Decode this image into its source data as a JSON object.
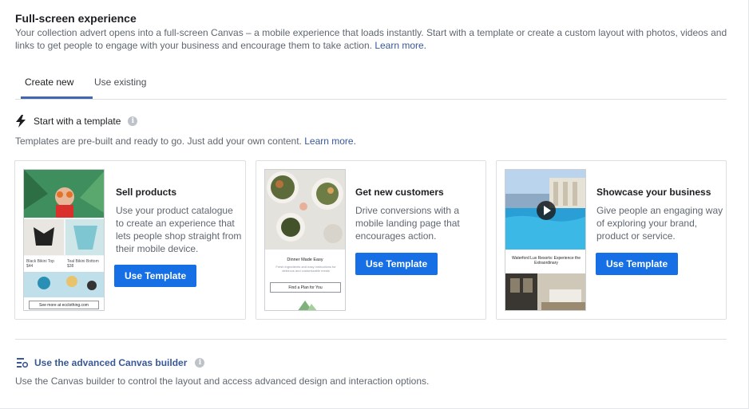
{
  "header": {
    "title": "Full-screen experience",
    "description": "Your collection advert opens into a full-screen Canvas – a mobile experience that loads instantly. Start with a template or create a custom layout with photos, videos and links to get people to engage with your business and encourage them to take action.",
    "learn_more": "Learn more."
  },
  "tabs": [
    {
      "label": "Create new",
      "active": true
    },
    {
      "label": "Use existing",
      "active": false
    }
  ],
  "template_section": {
    "heading": "Start with a template",
    "icon": "lightning-icon",
    "subtitle": "Templates are pre-built and ready to go. Just add your own content.",
    "learn_more": "Learn more."
  },
  "cards": [
    {
      "title": "Sell products",
      "description": "Use your product catalogue to create an experience that lets people shop straight from their mobile device.",
      "button": "Use Template",
      "thumb": {
        "footer_button": "See more at ecclothing.com"
      }
    },
    {
      "title": "Get new customers",
      "description": "Drive conversions with a mobile landing page that encourages action.",
      "button": "Use Template",
      "thumb": {
        "caption": "Dinner Made Easy",
        "footer_button": "Find a Plan for You"
      }
    },
    {
      "title": "Showcase your business",
      "description": "Give people an engaging way of exploring your brand, product or service.",
      "button": "Use Template",
      "thumb": {
        "caption": "Waterford Lux Resorts: Experience the Extraordinary"
      }
    }
  ],
  "advanced": {
    "heading": "Use the advanced Canvas builder",
    "icon": "canvas-builder-icon",
    "description": "Use the Canvas builder to control the layout and access advanced design and interaction options."
  },
  "colors": {
    "accent": "#166fe5",
    "link": "#385898",
    "tab_underline": "#4267b2"
  }
}
